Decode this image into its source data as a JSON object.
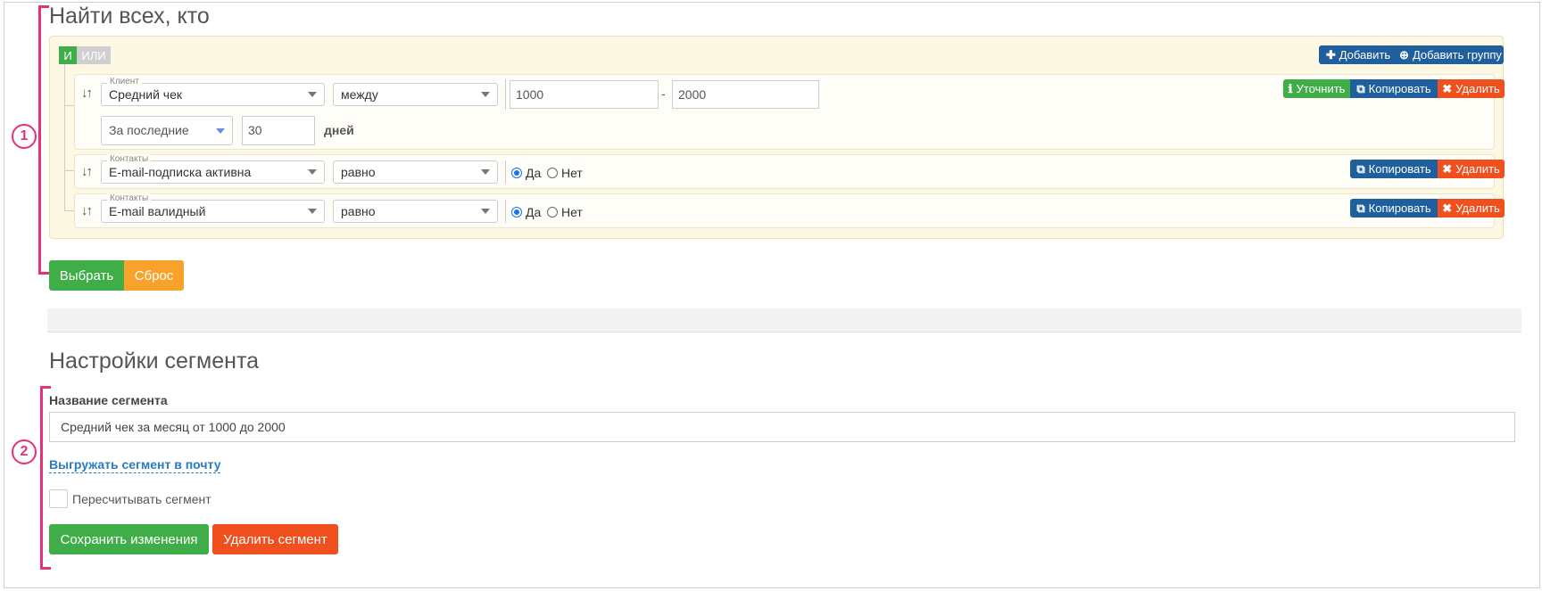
{
  "filter": {
    "title": "Найти всех, кто",
    "marker": "1",
    "toggle": {
      "and": "И",
      "or": "ИЛИ"
    },
    "actions": {
      "add": "Добавить",
      "add_group": "Добавить группу"
    },
    "rules": [
      {
        "field_group": "Клиент",
        "field": "Средний чек",
        "operator": "между",
        "value_from": "1000",
        "value_sep": "-",
        "value_to": "2000",
        "period_select": "За последние",
        "period_value": "30",
        "period_unit": "дней",
        "buttons": {
          "refine": "Уточнить",
          "copy": "Копировать",
          "delete": "Удалить"
        }
      },
      {
        "field_group": "Контакты",
        "field": "E-mail-подписка активна",
        "operator": "равно",
        "radio_yes": "Да",
        "radio_no": "Нет",
        "selected": "yes",
        "buttons": {
          "copy": "Копировать",
          "delete": "Удалить"
        }
      },
      {
        "field_group": "Контакты",
        "field": "E-mail валидный",
        "operator": "равно",
        "radio_yes": "Да",
        "radio_no": "Нет",
        "selected": "yes",
        "buttons": {
          "copy": "Копировать",
          "delete": "Удалить"
        }
      }
    ],
    "select_button": "Выбрать",
    "reset_button": "Сброс"
  },
  "settings": {
    "title": "Настройки сегмента",
    "marker": "2",
    "name_label": "Название сегмента",
    "name_value": "Средний чек за месяц от 1000 до 2000",
    "export_link": "Выгружать сегмент в почту",
    "recalc_label": "Пересчитывать сегмент",
    "recalc_checked": false,
    "save_button": "Сохранить изменения",
    "delete_button": "Удалить сегмент"
  },
  "colors": {
    "accent_marker": "#e5307a",
    "green": "#3fae49",
    "blue": "#1f5f9e",
    "red": "#f0501e",
    "orange": "#f8a12b"
  }
}
